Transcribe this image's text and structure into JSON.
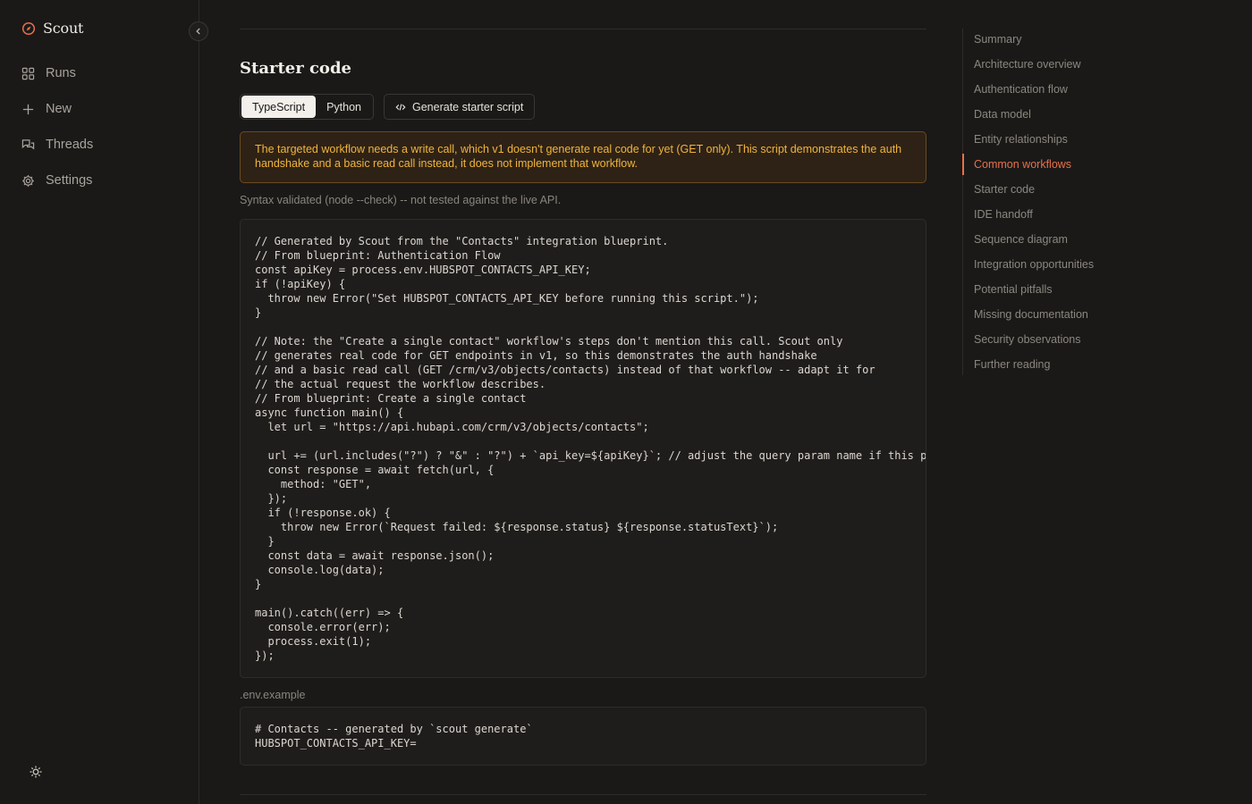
{
  "app": {
    "name": "Scout",
    "accent": "#e8704a"
  },
  "nav": {
    "items": [
      {
        "label": "Runs",
        "icon": "grid-icon"
      },
      {
        "label": "New",
        "icon": "plus-icon"
      },
      {
        "label": "Threads",
        "icon": "chat-icon"
      },
      {
        "label": "Settings",
        "icon": "gear-icon"
      }
    ]
  },
  "section": {
    "title": "Starter code",
    "tabs": [
      {
        "label": "TypeScript",
        "active": true
      },
      {
        "label": "Python",
        "active": false
      }
    ],
    "generate_label": "Generate starter script",
    "warning": "The targeted workflow needs a write call, which v1 doesn't generate real code for yet (GET only). This script demonstrates the auth handshake and a basic read call instead, it does not implement that workflow.",
    "validated_note": "Syntax validated (node --check) -- not tested against the live API.",
    "code": "// Generated by Scout from the \"Contacts\" integration blueprint.\n// From blueprint: Authentication Flow\nconst apiKey = process.env.HUBSPOT_CONTACTS_API_KEY;\nif (!apiKey) {\n  throw new Error(\"Set HUBSPOT_CONTACTS_API_KEY before running this script.\");\n}\n\n// Note: the \"Create a single contact\" workflow's steps don't mention this call. Scout only\n// generates real code for GET endpoints in v1, so this demonstrates the auth handshake\n// and a basic read call (GET /crm/v3/objects/contacts) instead of that workflow -- adapt it for\n// the actual request the workflow describes.\n// From blueprint: Create a single contact\nasync function main() {\n  let url = \"https://api.hubapi.com/crm/v3/objects/contacts\";\n\n  url += (url.includes(\"?\") ? \"&\" : \"?\") + `api_key=${apiKey}`; // adjust the query param name if this p\n  const response = await fetch(url, {\n    method: \"GET\",\n  });\n  if (!response.ok) {\n    throw new Error(`Request failed: ${response.status} ${response.statusText}`);\n  }\n  const data = await response.json();\n  console.log(data);\n}\n\nmain().catch((err) => {\n  console.error(err);\n  process.exit(1);\n});",
    "env_label": ".env.example",
    "env_code": "# Contacts -- generated by `scout generate`\nHUBSPOT_CONTACTS_API_KEY="
  },
  "toc": {
    "items": [
      {
        "label": "Summary",
        "active": false
      },
      {
        "label": "Architecture overview",
        "active": false
      },
      {
        "label": "Authentication flow",
        "active": false
      },
      {
        "label": "Data model",
        "active": false
      },
      {
        "label": "Entity relationships",
        "active": false
      },
      {
        "label": "Common workflows",
        "active": true
      },
      {
        "label": "Starter code",
        "active": false
      },
      {
        "label": "IDE handoff",
        "active": false
      },
      {
        "label": "Sequence diagram",
        "active": false
      },
      {
        "label": "Integration opportunities",
        "active": false
      },
      {
        "label": "Potential pitfalls",
        "active": false
      },
      {
        "label": "Missing documentation",
        "active": false
      },
      {
        "label": "Security observations",
        "active": false
      },
      {
        "label": "Further reading",
        "active": false
      }
    ]
  }
}
